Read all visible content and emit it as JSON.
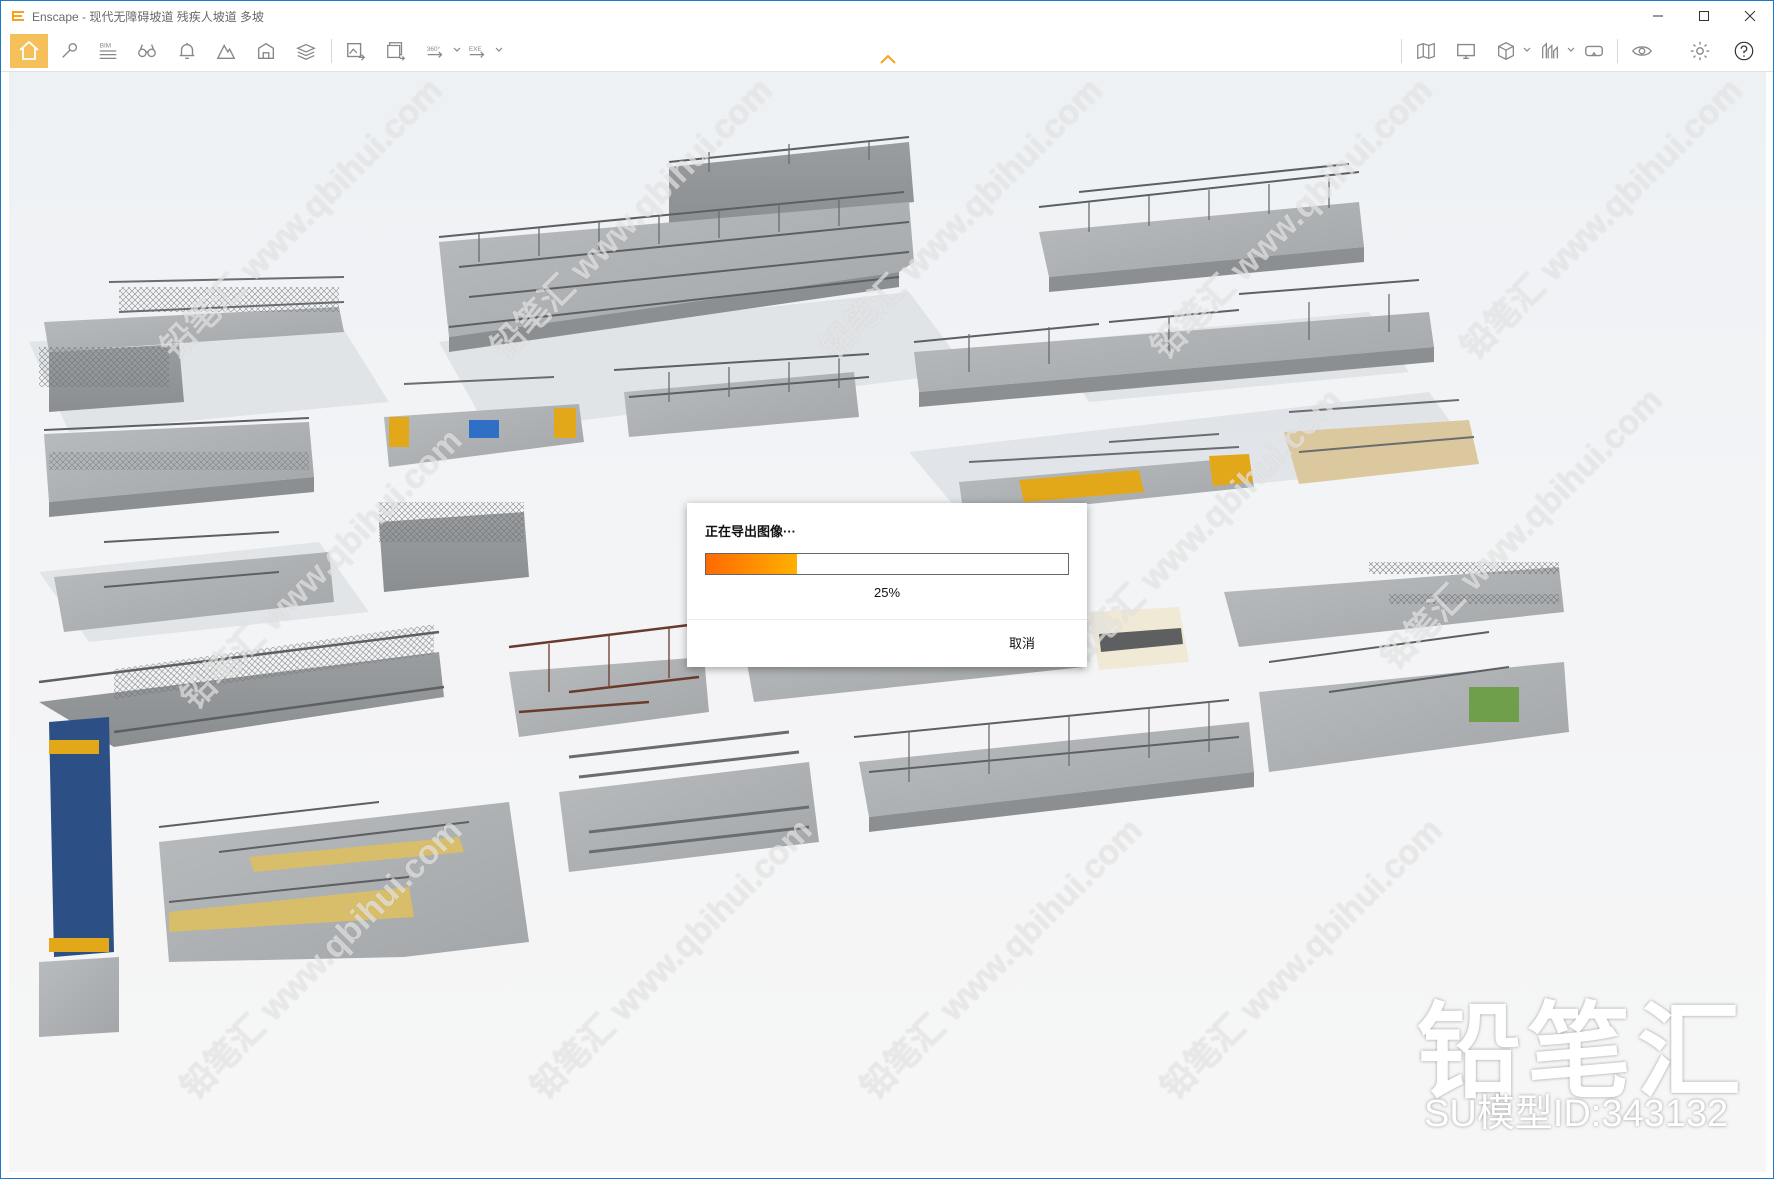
{
  "window": {
    "title": "Enscape - 现代无障碍坡道 残疾人坡道 多坡",
    "accent_color": "#f7b23b",
    "border_color": "#1e78c8"
  },
  "toolbar": {
    "left_icons": [
      "home-icon",
      "pin-icon",
      "bim-icon",
      "binoculars-icon",
      "bell-icon",
      "mountain-icon",
      "building-icon",
      "layers-icon"
    ],
    "export_icons": [
      "export-image-icon",
      "batch-export-icon",
      "panorama-360-icon",
      "export-exe-icon"
    ],
    "right_icons": [
      "map-icon",
      "monitor-icon",
      "cube-icon",
      "assets-icon",
      "vr-headset-icon",
      "visual-settings-icon",
      "settings-icon",
      "help-icon"
    ],
    "bim_label": "BIM",
    "p360_label": "360°",
    "exe_label": "EXE"
  },
  "watermark": {
    "repeat_text": "铅笔汇 www.qbihui.com",
    "brand": "铅笔汇",
    "model_id": "SU模型ID:343132"
  },
  "dialog": {
    "title": "正在导出图像···",
    "progress": 0.25,
    "percent_text": "25%",
    "cancel_label": "取消",
    "progress_colors": [
      "#ff6a00",
      "#ffb000"
    ]
  }
}
